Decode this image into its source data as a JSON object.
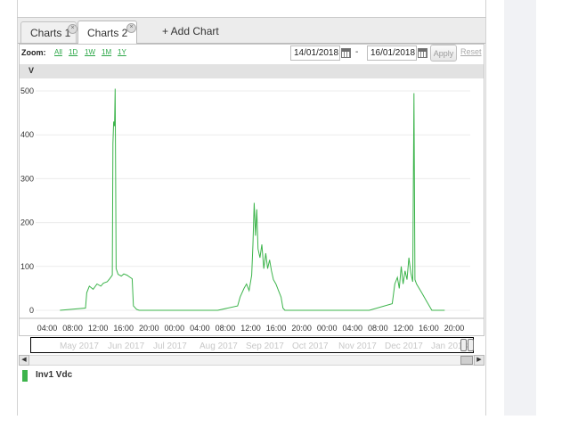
{
  "tabs": [
    {
      "label": "Charts 1",
      "close": "×"
    },
    {
      "label": "Charts 2",
      "close": "×"
    }
  ],
  "add_chart_label": "+ Add Chart",
  "toolbar": {
    "zoom_label": "Zoom:",
    "zoom_options": [
      "All",
      "1D",
      "1W",
      "1M",
      "1Y"
    ],
    "from_date": "14/01/2018",
    "date_separator": "-",
    "to_date": "16/01/2018",
    "apply_label": "Apply",
    "reset_label": "Reset"
  },
  "y_axis_unit": "V",
  "colors": {
    "series": "#3cb44b",
    "grid": "#ececec",
    "axis_text": "#333333"
  },
  "icons": {
    "calendar": "calendar-icon",
    "scroll_left": "chevron-left-icon",
    "scroll_right": "chevron-right-icon"
  },
  "chart_data": {
    "type": "line",
    "title": "",
    "xlabel": "",
    "ylabel": "V",
    "ylim": [
      0,
      500
    ],
    "y_ticks": [
      0,
      100,
      200,
      300,
      400,
      500
    ],
    "x_ticks": [
      "04:00",
      "08:00",
      "12:00",
      "16:00",
      "20:00",
      "00:00",
      "04:00",
      "08:00",
      "12:00",
      "16:00",
      "20:00",
      "00:00",
      "04:00",
      "08:00",
      "12:00",
      "16:00",
      "20:00"
    ],
    "x_range_hours": [
      0,
      68
    ],
    "legend_position": "bottom-left",
    "series": [
      {
        "name": "Inv1 Vdc",
        "points": [
          [
            3.8,
            0
          ],
          [
            7.8,
            5
          ],
          [
            8.0,
            40
          ],
          [
            8.4,
            55
          ],
          [
            9.0,
            48
          ],
          [
            9.6,
            60
          ],
          [
            10.2,
            55
          ],
          [
            10.6,
            62
          ],
          [
            11.2,
            65
          ],
          [
            11.6,
            72
          ],
          [
            12.0,
            80
          ],
          [
            12.1,
            380
          ],
          [
            12.2,
            430
          ],
          [
            12.35,
            420
          ],
          [
            12.45,
            505
          ],
          [
            12.6,
            95
          ],
          [
            12.9,
            82
          ],
          [
            13.4,
            78
          ],
          [
            13.8,
            83
          ],
          [
            14.3,
            80
          ],
          [
            14.8,
            75
          ],
          [
            15.1,
            72
          ],
          [
            15.3,
            10
          ],
          [
            15.8,
            2
          ],
          [
            16.2,
            0
          ],
          [
            24,
            0
          ],
          [
            28.5,
            0
          ],
          [
            31.6,
            10
          ],
          [
            32.0,
            30
          ],
          [
            32.6,
            50
          ],
          [
            33.0,
            60
          ],
          [
            33.4,
            45
          ],
          [
            33.8,
            80
          ],
          [
            34.0,
            150
          ],
          [
            34.2,
            245
          ],
          [
            34.4,
            170
          ],
          [
            34.6,
            230
          ],
          [
            34.8,
            140
          ],
          [
            35.1,
            120
          ],
          [
            35.4,
            150
          ],
          [
            35.7,
            95
          ],
          [
            36.0,
            130
          ],
          [
            36.3,
            95
          ],
          [
            36.6,
            115
          ],
          [
            36.9,
            90
          ],
          [
            37.2,
            70
          ],
          [
            37.6,
            60
          ],
          [
            38.0,
            45
          ],
          [
            38.4,
            30
          ],
          [
            38.7,
            5
          ],
          [
            39.0,
            0
          ],
          [
            48,
            0
          ],
          [
            52.2,
            0
          ],
          [
            55.8,
            15
          ],
          [
            56.2,
            60
          ],
          [
            56.6,
            75
          ],
          [
            56.9,
            50
          ],
          [
            57.2,
            100
          ],
          [
            57.5,
            60
          ],
          [
            57.8,
            90
          ],
          [
            58.1,
            70
          ],
          [
            58.4,
            120
          ],
          [
            58.7,
            85
          ],
          [
            59.0,
            65
          ],
          [
            59.2,
            495
          ],
          [
            59.35,
            70
          ],
          [
            59.6,
            60
          ],
          [
            60.4,
            40
          ],
          [
            61.2,
            20
          ],
          [
            62.0,
            0
          ],
          [
            64,
            0
          ]
        ]
      }
    ]
  },
  "navigator": {
    "labels": [
      "May 2017",
      "Jun 2017",
      "Jul 2017",
      "Aug 2017",
      "Sep 2017",
      "Oct 2017",
      "Nov 2017",
      "Dec 2017",
      "Jan 2018"
    ]
  }
}
